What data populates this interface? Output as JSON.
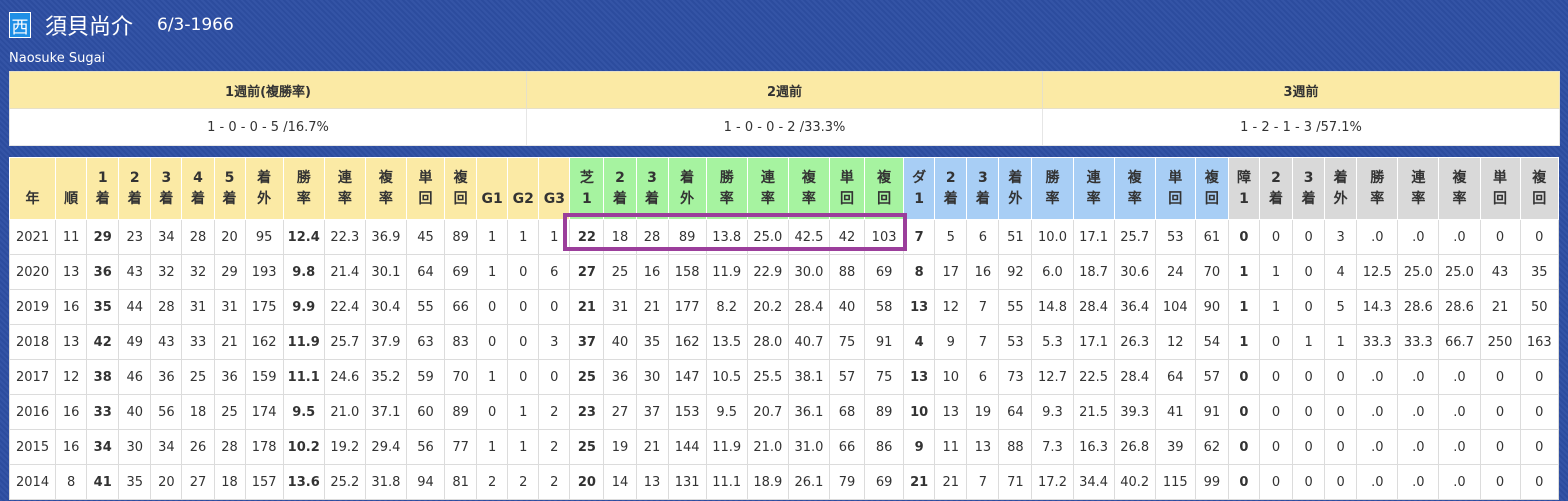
{
  "header": {
    "region_badge": "西",
    "name_jp": "須貝尚介",
    "dob": "6/3-1966",
    "name_en": "Naosuke Sugai"
  },
  "summary": {
    "headers": [
      "1週前(複勝率)",
      "2週前",
      "3週前"
    ],
    "values": [
      "1 - 0 - 0 - 5 /16.7%",
      "1 - 0 - 0 - 2 /33.3%",
      "1 - 2 - 1 - 3 /57.1%"
    ]
  },
  "stats_table": {
    "columns": [
      {
        "l1": "",
        "l2": "年"
      },
      {
        "l1": "",
        "l2": "順"
      },
      {
        "l1": "1",
        "l2": "着"
      },
      {
        "l1": "2",
        "l2": "着"
      },
      {
        "l1": "3",
        "l2": "着"
      },
      {
        "l1": "4",
        "l2": "着"
      },
      {
        "l1": "5",
        "l2": "着"
      },
      {
        "l1": "着",
        "l2": "外"
      },
      {
        "l1": "勝",
        "l2": "率"
      },
      {
        "l1": "連",
        "l2": "率"
      },
      {
        "l1": "複",
        "l2": "率"
      },
      {
        "l1": "単",
        "l2": "回"
      },
      {
        "l1": "複",
        "l2": "回"
      },
      {
        "l1": "",
        "l2": "G1"
      },
      {
        "l1": "",
        "l2": "G2"
      },
      {
        "l1": "",
        "l2": "G3"
      },
      {
        "l1": "芝",
        "l2": "1"
      },
      {
        "l1": "2",
        "l2": "着"
      },
      {
        "l1": "3",
        "l2": "着"
      },
      {
        "l1": "着",
        "l2": "外"
      },
      {
        "l1": "勝",
        "l2": "率"
      },
      {
        "l1": "連",
        "l2": "率"
      },
      {
        "l1": "複",
        "l2": "率"
      },
      {
        "l1": "単",
        "l2": "回"
      },
      {
        "l1": "複",
        "l2": "回"
      },
      {
        "l1": "ダ",
        "l2": "1"
      },
      {
        "l1": "2",
        "l2": "着"
      },
      {
        "l1": "3",
        "l2": "着"
      },
      {
        "l1": "着",
        "l2": "外"
      },
      {
        "l1": "勝",
        "l2": "率"
      },
      {
        "l1": "連",
        "l2": "率"
      },
      {
        "l1": "複",
        "l2": "率"
      },
      {
        "l1": "単",
        "l2": "回"
      },
      {
        "l1": "複",
        "l2": "回"
      },
      {
        "l1": "障",
        "l2": "1"
      },
      {
        "l1": "2",
        "l2": "着"
      },
      {
        "l1": "3",
        "l2": "着"
      },
      {
        "l1": "着",
        "l2": "外"
      },
      {
        "l1": "勝",
        "l2": "率"
      },
      {
        "l1": "連",
        "l2": "率"
      },
      {
        "l1": "複",
        "l2": "率"
      },
      {
        "l1": "単",
        "l2": "回"
      },
      {
        "l1": "複",
        "l2": "回"
      }
    ],
    "rows": [
      [
        "2021",
        "11",
        "29",
        "23",
        "34",
        "28",
        "20",
        "95",
        "12.4",
        "22.3",
        "36.9",
        "45",
        "89",
        "1",
        "1",
        "1",
        "22",
        "18",
        "28",
        "89",
        "13.8",
        "25.0",
        "42.5",
        "42",
        "103",
        "7",
        "5",
        "6",
        "51",
        "10.0",
        "17.1",
        "25.7",
        "53",
        "61",
        "0",
        "0",
        "0",
        "3",
        ".0",
        ".0",
        ".0",
        "0",
        "0"
      ],
      [
        "2020",
        "13",
        "36",
        "43",
        "32",
        "32",
        "29",
        "193",
        "9.8",
        "21.4",
        "30.1",
        "64",
        "69",
        "1",
        "0",
        "6",
        "27",
        "25",
        "16",
        "158",
        "11.9",
        "22.9",
        "30.0",
        "88",
        "69",
        "8",
        "17",
        "16",
        "92",
        "6.0",
        "18.7",
        "30.6",
        "24",
        "70",
        "1",
        "1",
        "0",
        "4",
        "12.5",
        "25.0",
        "25.0",
        "43",
        "35"
      ],
      [
        "2019",
        "16",
        "35",
        "44",
        "28",
        "31",
        "31",
        "175",
        "9.9",
        "22.4",
        "30.4",
        "55",
        "66",
        "0",
        "0",
        "0",
        "21",
        "31",
        "21",
        "177",
        "8.2",
        "20.2",
        "28.4",
        "40",
        "58",
        "13",
        "12",
        "7",
        "55",
        "14.8",
        "28.4",
        "36.4",
        "104",
        "90",
        "1",
        "1",
        "0",
        "5",
        "14.3",
        "28.6",
        "28.6",
        "21",
        "50"
      ],
      [
        "2018",
        "13",
        "42",
        "49",
        "43",
        "33",
        "21",
        "162",
        "11.9",
        "25.7",
        "37.9",
        "63",
        "83",
        "0",
        "0",
        "3",
        "37",
        "40",
        "35",
        "162",
        "13.5",
        "28.0",
        "40.7",
        "75",
        "91",
        "4",
        "9",
        "7",
        "53",
        "5.3",
        "17.1",
        "26.3",
        "12",
        "54",
        "1",
        "0",
        "1",
        "1",
        "33.3",
        "33.3",
        "66.7",
        "250",
        "163"
      ],
      [
        "2017",
        "12",
        "38",
        "46",
        "36",
        "25",
        "36",
        "159",
        "11.1",
        "24.6",
        "35.2",
        "59",
        "70",
        "1",
        "0",
        "0",
        "25",
        "36",
        "30",
        "147",
        "10.5",
        "25.5",
        "38.1",
        "57",
        "75",
        "13",
        "10",
        "6",
        "73",
        "12.7",
        "22.5",
        "28.4",
        "64",
        "57",
        "0",
        "0",
        "0",
        "0",
        ".0",
        ".0",
        ".0",
        "0",
        "0"
      ],
      [
        "2016",
        "16",
        "33",
        "40",
        "56",
        "18",
        "25",
        "174",
        "9.5",
        "21.0",
        "37.1",
        "60",
        "89",
        "0",
        "1",
        "2",
        "23",
        "27",
        "37",
        "153",
        "9.5",
        "20.7",
        "36.1",
        "68",
        "89",
        "10",
        "13",
        "19",
        "64",
        "9.3",
        "21.5",
        "39.3",
        "41",
        "91",
        "0",
        "0",
        "0",
        "0",
        ".0",
        ".0",
        ".0",
        "0",
        "0"
      ],
      [
        "2015",
        "16",
        "34",
        "30",
        "34",
        "26",
        "28",
        "178",
        "10.2",
        "19.2",
        "29.4",
        "56",
        "77",
        "1",
        "1",
        "2",
        "25",
        "19",
        "21",
        "144",
        "11.9",
        "21.0",
        "31.0",
        "66",
        "86",
        "9",
        "11",
        "13",
        "88",
        "7.3",
        "16.3",
        "26.8",
        "39",
        "62",
        "0",
        "0",
        "0",
        "0",
        ".0",
        ".0",
        ".0",
        "0",
        "0"
      ],
      [
        "2014",
        "8",
        "41",
        "35",
        "20",
        "27",
        "18",
        "157",
        "13.6",
        "25.2",
        "31.8",
        "94",
        "81",
        "2",
        "2",
        "2",
        "20",
        "14",
        "13",
        "131",
        "11.1",
        "18.9",
        "26.1",
        "79",
        "69",
        "21",
        "21",
        "7",
        "71",
        "17.2",
        "34.4",
        "40.2",
        "115",
        "99",
        "0",
        "0",
        "0",
        "0",
        ".0",
        ".0",
        ".0",
        "0",
        "0"
      ]
    ]
  },
  "colors": {
    "background": "#2d4ea3",
    "header_yellow": "#fbeaa5",
    "turf_green": "#a6f3a0",
    "dirt_blue": "#a8cef5",
    "jump_gray": "#d9d9d9",
    "highlight_border": "#9b3e9b"
  }
}
